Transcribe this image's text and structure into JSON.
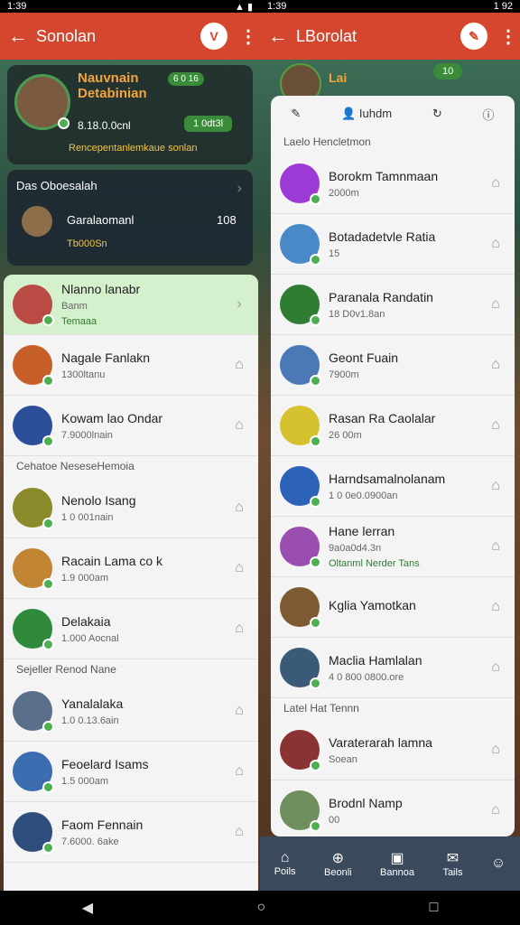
{
  "status": {
    "left_time": "1:39",
    "right_time": "1:39",
    "right_battery": "1 92"
  },
  "left": {
    "appbar": {
      "title": "Sonolan"
    },
    "profile": {
      "name": "Nauvnain Detabinian",
      "points": "6 0 16",
      "count": "8.18.0.0cnl",
      "badge": "1 0dt3l",
      "tagline": "Rencepentanlemkaue sonlan"
    },
    "group": {
      "title": "Das Oboesalah",
      "member": "Garalaomanl",
      "count": "108",
      "sub": "Tb000Sn"
    },
    "rows": [
      {
        "name": "Nlanno lanabr",
        "sub": "Banm",
        "extra": "Temaaa",
        "highlight": true,
        "avatar_color": "#b94a44"
      },
      {
        "name": "Nagale Fanlakn",
        "sub": "1300ltanu",
        "avatar_color": "#c76028"
      },
      {
        "name": "Kowam lao Ondar",
        "sub": "7.9000lnain",
        "avatar_color": "#2d4f9a"
      },
      {
        "section": "Cehatoe  NeseseHemoia"
      },
      {
        "name": "Nenolo Isang",
        "sub": "1 0 001nain",
        "avatar_color": "#8a8a2a"
      },
      {
        "name": "Racain Lama co k",
        "sub": "1.9 000am",
        "avatar_color": "#c28533"
      },
      {
        "name": "Delakaia",
        "sub": "1.000 Aocnal",
        "avatar_color": "#2f8a3b"
      },
      {
        "section": "Sejeller    Renod Nane"
      },
      {
        "name": "Yanalalaka",
        "sub": "1.0 0.13.6ain",
        "avatar_color": "#5a6f8a"
      },
      {
        "name": "Feoelard Isams",
        "sub": "1.5 000am",
        "avatar_color": "#3d6db1"
      },
      {
        "name": "Faom Fennain",
        "sub": "7.6000. 6ake",
        "avatar_color": "#2e4f7d"
      }
    ]
  },
  "right": {
    "appbar": {
      "title": "LBorolat"
    },
    "profile": {
      "name": "Lai",
      "score": "10",
      "icon": "badge"
    },
    "toolbar": {
      "label": "Iuhdm"
    },
    "section": "Laelo Hencletmon",
    "rows": [
      {
        "name": "Borokm Tamnmaan",
        "sub": "2000m",
        "avatar_color": "#9c3ad6"
      },
      {
        "name": "Botadadetvle Ratia",
        "sub": "15",
        "avatar_color": "#4a89c8"
      },
      {
        "name": "Paranala Randatin",
        "sub": "18 D0v1.8an",
        "avatar_color": "#2e7d32"
      },
      {
        "name": "Geont Fuain",
        "sub": "7900m",
        "avatar_color": "#4a79b5"
      },
      {
        "name": "Rasan Ra Caolalar",
        "sub": "26 00m",
        "avatar_color": "#d6c22e"
      },
      {
        "name": "Harndsamalnolanam",
        "sub": "1 0 0e0.0900an",
        "avatar_color": "#2c62b8"
      },
      {
        "name": "Hane lerran",
        "sub": "9a0a0d4.3n",
        "extra": "Oltanml Nerder Tans",
        "avatar_color": "#9a4fb0"
      },
      {
        "name": "Kglia Yamotkan",
        "sub": "",
        "avatar_color": "#7e5a32"
      },
      {
        "name": "Maclia Hamlalan",
        "sub": "4 0 800 0800.ore",
        "avatar_color": "#3a5a78"
      },
      {
        "section": "Latel Hat Tennn"
      },
      {
        "name": "Varaterarah lamna",
        "sub": "Soean",
        "avatar_color": "#8a3333"
      },
      {
        "name": "Brodnl Namp",
        "sub": "00",
        "avatar_color": "#6f8f5e"
      }
    ],
    "tabs": [
      "Poils",
      "Beonli",
      "Bannoa",
      "Tails",
      ""
    ]
  }
}
